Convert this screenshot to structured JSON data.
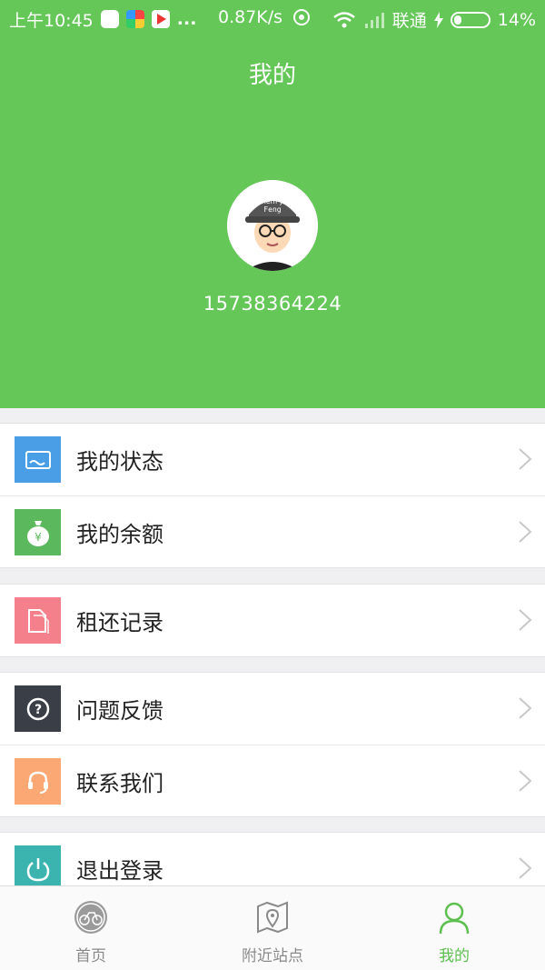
{
  "status_bar": {
    "time": "上午10:45",
    "more": "...",
    "speed": "0.87K/s",
    "carrier": "联通",
    "battery": "14%"
  },
  "header": {
    "title": "我的",
    "phone": "15738364224",
    "avatar_text": "Henry Feng"
  },
  "menu": {
    "status_label": "我的状态",
    "balance_label": "我的余额",
    "records_label": "租还记录",
    "feedback_label": "问题反馈",
    "contact_label": "联系我们",
    "logout_label": "退出登录"
  },
  "tabs": {
    "home": "首页",
    "nearby": "附近站点",
    "mine": "我的"
  },
  "colors": {
    "brand_green": "#64c757",
    "status_icon": "#4a9ee6",
    "balance_icon": "#5cb85c",
    "records_icon": "#f4808c",
    "feedback_icon": "#3a3f47",
    "contact_icon": "#fca874",
    "logout_icon": "#3bb4b0"
  }
}
